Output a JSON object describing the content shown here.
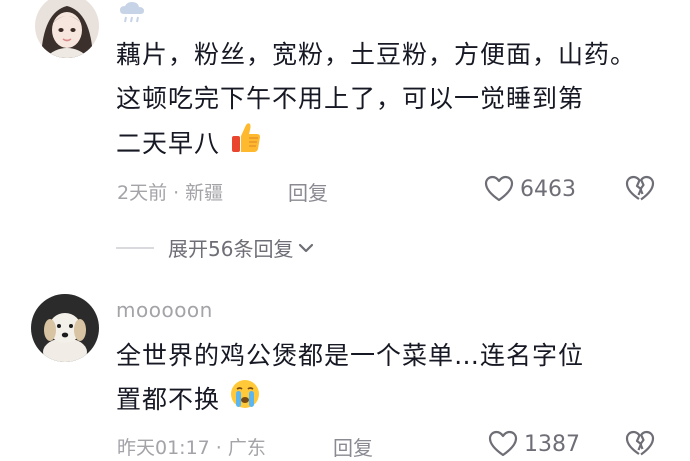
{
  "comments": [
    {
      "username": "",
      "text_lines": [
        "藕片，粉丝，宽粉，土豆粉，方便面，山药。",
        "这顿吃完下午不用上了，可以一觉睡到第",
        "二天早八"
      ],
      "emoji": "thumbs-up-icon",
      "time": "2天前",
      "location": "新疆",
      "reply_label": "回复",
      "likes": "6463",
      "expand_label": "展开56条回复"
    },
    {
      "username": "mooooon",
      "text_lines": [
        "全世界的鸡公煲都是一个菜单…连名字位",
        "置都不换"
      ],
      "emoji": "crying-face-icon",
      "time": "昨天01:17",
      "location": "广东",
      "reply_label": "回复",
      "likes": "1387"
    }
  ],
  "separator": "·",
  "colors": {
    "text": "#161823",
    "meta": "#a3a3a8",
    "icon": "#6e6e76"
  }
}
